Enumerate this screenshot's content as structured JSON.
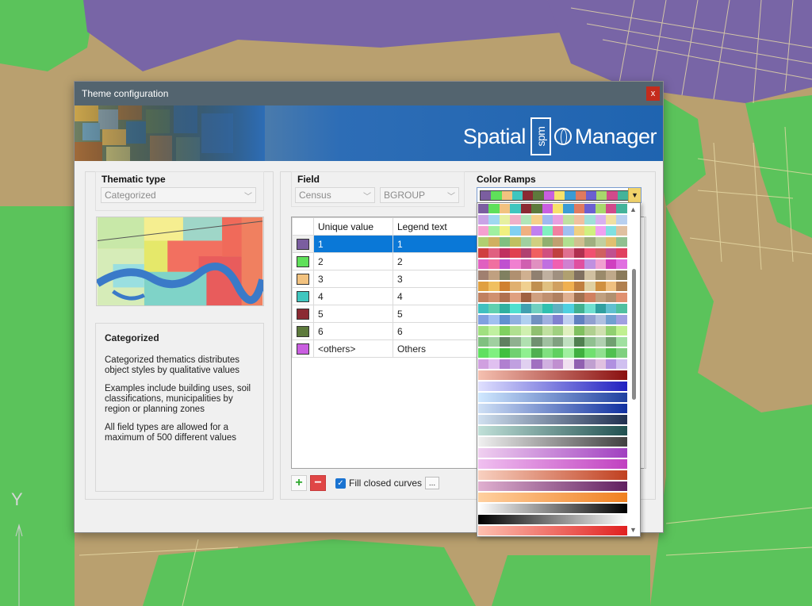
{
  "dialog": {
    "title": "Theme configuration",
    "close_glyph": "x",
    "brand": {
      "left": "Spatial",
      "mark": "spm",
      "right": "Manager"
    }
  },
  "thematic_type": {
    "label": "Thematic type",
    "value": "Categorized",
    "description_title": "Categorized",
    "description": [
      "Categorized thematics distributes object styles by qualitative values",
      "Examples include building uses, soil classifications, municipalities by region or planning zones",
      "All field types are allowed for a maximum of 500 different values"
    ]
  },
  "field": {
    "label": "Field",
    "table_value": "Census",
    "field_value": "BGROUP"
  },
  "color_ramps": {
    "label": "Color Ramps"
  },
  "grid": {
    "headers": [
      "Unique value",
      "Legend text"
    ],
    "rows": [
      {
        "color": "#7b5ea0",
        "value": "1",
        "legend": "1",
        "selected": true
      },
      {
        "color": "#5fe05a",
        "value": "2",
        "legend": "2"
      },
      {
        "color": "#f2c27f",
        "value": "3",
        "legend": "3"
      },
      {
        "color": "#3fc6bf",
        "value": "4",
        "legend": "4"
      },
      {
        "color": "#8b2a33",
        "value": "5",
        "legend": "5"
      },
      {
        "color": "#5d7a3c",
        "value": "6",
        "legend": "6"
      },
      {
        "color": "#c95ee0",
        "value": "<others>",
        "legend": "Others"
      }
    ]
  },
  "bottom": {
    "add_glyph": "+",
    "remove_glyph": "−",
    "fill_closed_curves": "Fill closed curves",
    "fill_checked": true,
    "more_glyph": "..."
  },
  "scroll": {
    "up": "▲",
    "down": "▼"
  },
  "map": {
    "axis_label": "Y"
  }
}
